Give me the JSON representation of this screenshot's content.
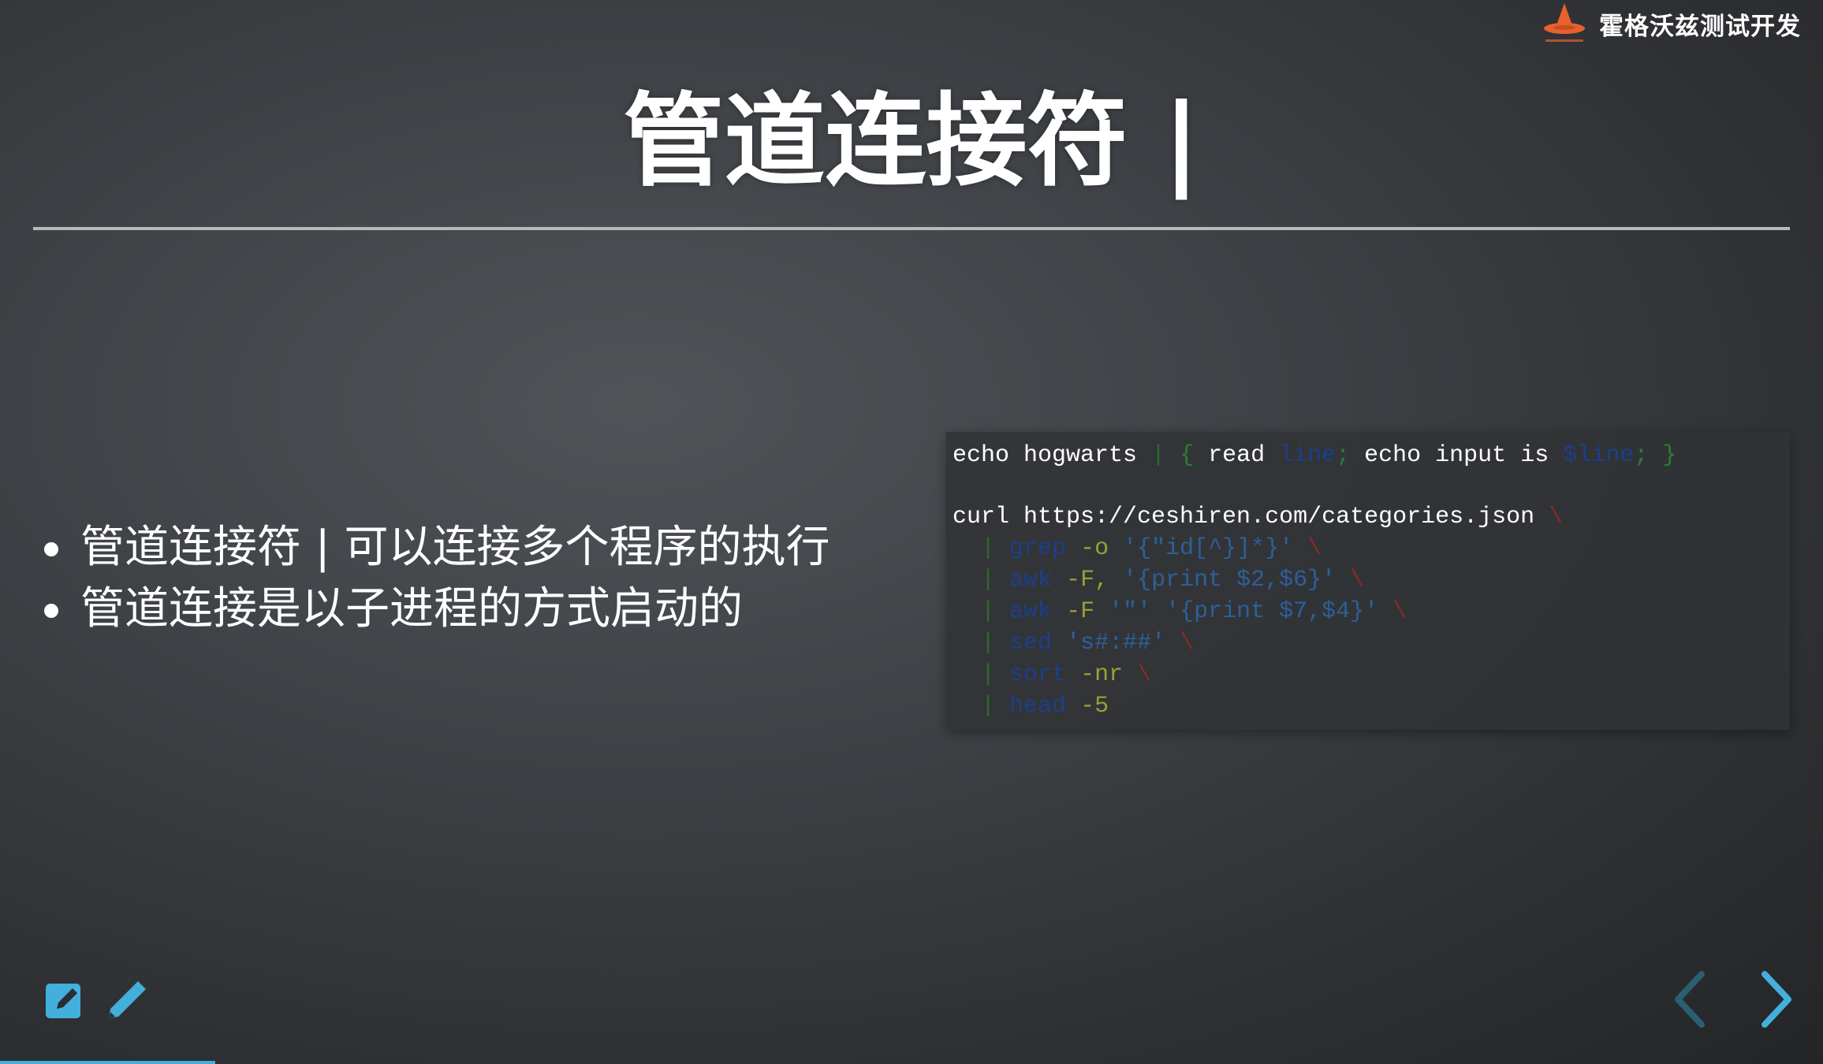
{
  "brand": {
    "name": "霍格沃兹测试开发",
    "logo_icon": "wizard-hat-icon"
  },
  "slide": {
    "title": "管道连接符 |",
    "bullets": [
      "管道连接符 | 可以连接多个程序的执行",
      "管道连接是以子进程的方式启动的"
    ],
    "code": {
      "line1": {
        "t1": "echo hogwarts ",
        "t2": "|",
        "t3": " ",
        "t4": "{",
        "t5": " read ",
        "t6": "line",
        "t7": ";",
        "t8": " echo input is ",
        "t9": "$line",
        "t10": ";",
        "t11": " ",
        "t12": "}"
      },
      "line2": {
        "t1": "curl https://ceshiren.com/categories.json ",
        "t2": "\\"
      },
      "pipeline": [
        {
          "pipe": "|",
          "cmd": "grep",
          "opt": " -o",
          "arg": " '{\"id[^}]*}'",
          "esc": " \\"
        },
        {
          "pipe": "|",
          "cmd": "awk",
          "opt": " -F,",
          "arg": " '{print $2,$6}'",
          "esc": " \\"
        },
        {
          "pipe": "|",
          "cmd": "awk",
          "opt": " -F",
          "arg": " '\"' '{print $7,$4}'",
          "esc": " \\"
        },
        {
          "pipe": "|",
          "cmd": "sed",
          "opt": "",
          "arg": " 's#:##'",
          "esc": " \\"
        },
        {
          "pipe": "|",
          "cmd": "sort",
          "opt": " -nr",
          "arg": "",
          "esc": " \\"
        },
        {
          "pipe": "|",
          "cmd": "head",
          "opt": " -5",
          "arg": "",
          "esc": ""
        }
      ]
    }
  },
  "toolbar": {
    "left_icons": [
      "edit-slide-icon",
      "pencil-icon"
    ],
    "nav_icons": [
      "chevron-left-icon",
      "chevron-right-icon"
    ]
  },
  "progress": 0.118,
  "colors": {
    "accent": "#42afdc",
    "brand_orange": "#e8612c",
    "keyword": "#1c3f8c",
    "string": "#2e5f9a",
    "option": "#9aa035",
    "pipe": "#2c6a2a",
    "escape": "#8a2a28"
  }
}
